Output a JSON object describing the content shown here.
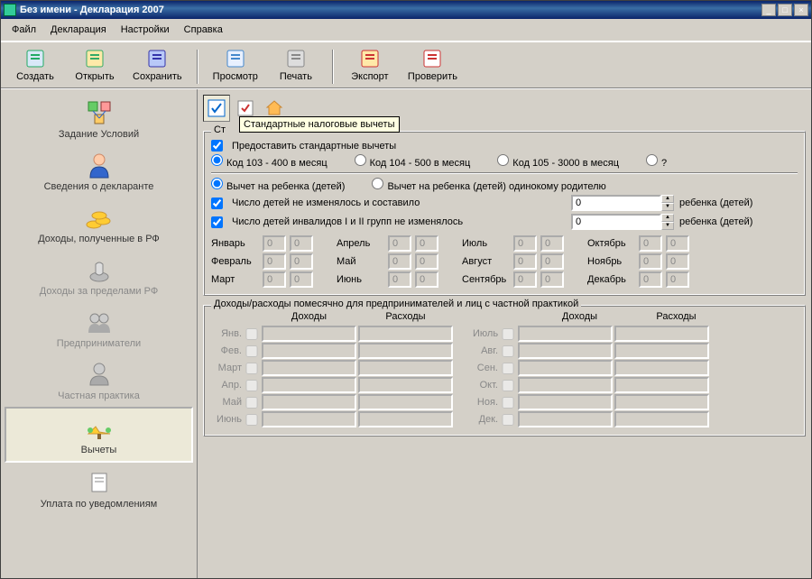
{
  "title": "Без имени - Декларация 2007",
  "menu": [
    "Файл",
    "Декларация",
    "Настройки",
    "Справка"
  ],
  "toolbar": [
    {
      "label": "Создать",
      "icon": "#d8e8f8",
      "accent": "#2a6"
    },
    {
      "label": "Открыть",
      "icon": "#ffe9a8",
      "accent": "#3a6"
    },
    {
      "label": "Сохранить",
      "icon": "#b8c8f8",
      "accent": "#33a"
    },
    {
      "label": "Просмотр",
      "icon": "#e8f0ff",
      "accent": "#48c"
    },
    {
      "label": "Печать",
      "icon": "#ddd",
      "accent": "#888"
    },
    {
      "label": "Экспорт",
      "icon": "#ffe9a8",
      "accent": "#c33"
    },
    {
      "label": "Проверить",
      "icon": "#fff",
      "accent": "#c33"
    }
  ],
  "tooltip": "Стандартные налоговые вычеты",
  "sidebar": [
    {
      "label": "Задание Условий",
      "disabled": false
    },
    {
      "label": "Сведения о декларанте",
      "disabled": false
    },
    {
      "label": "Доходы, полученные в РФ",
      "disabled": false
    },
    {
      "label": "Доходы за пределами РФ",
      "disabled": true
    },
    {
      "label": "Предприниматели",
      "disabled": true
    },
    {
      "label": "Частная практика",
      "disabled": true
    },
    {
      "label": "Вычеты",
      "disabled": false,
      "selected": true
    },
    {
      "label": "Уплата по уведомлениям",
      "disabled": false
    }
  ],
  "group1": {
    "legend": "Стандартные налоговые вычеты",
    "cb_provide": "Предоставить стандартные вычеты",
    "radios": [
      "Код 103 - 400 в месяц",
      "Код 104 - 500 в месяц",
      "Код 105 - 3000 в месяц",
      "?"
    ],
    "r2": [
      "Вычет на ребенка (детей)",
      "Вычет на ребенка (детей) одинокому родителю"
    ],
    "cb_children": "Число детей не изменялось и составило",
    "children_val": "0",
    "children_suffix": "ребенка (детей)",
    "cb_invalid": "Число детей инвалидов I и II групп не изменялось",
    "invalid_val": "0",
    "invalid_suffix": "ребенка (детей)",
    "months": [
      "Январь",
      "Февраль",
      "Март",
      "Апрель",
      "Май",
      "Июнь",
      "Июль",
      "Август",
      "Сентябрь",
      "Октябрь",
      "Ноябрь",
      "Декабрь"
    ],
    "month_vals": [
      "0",
      "0",
      "0",
      "0",
      "0",
      "0",
      "0",
      "0",
      "0",
      "0",
      "0",
      "0"
    ]
  },
  "group2": {
    "legend": "Доходы/расходы помесячно для предпринимателей и лиц с частной практикой",
    "col_income": "Доходы",
    "col_expense": "Расходы",
    "months_short": [
      "Янв.",
      "Фев.",
      "Март",
      "Апр.",
      "Май",
      "Июнь",
      "Июль",
      "Авг.",
      "Сен.",
      "Окт.",
      "Ноя.",
      "Дек."
    ]
  }
}
